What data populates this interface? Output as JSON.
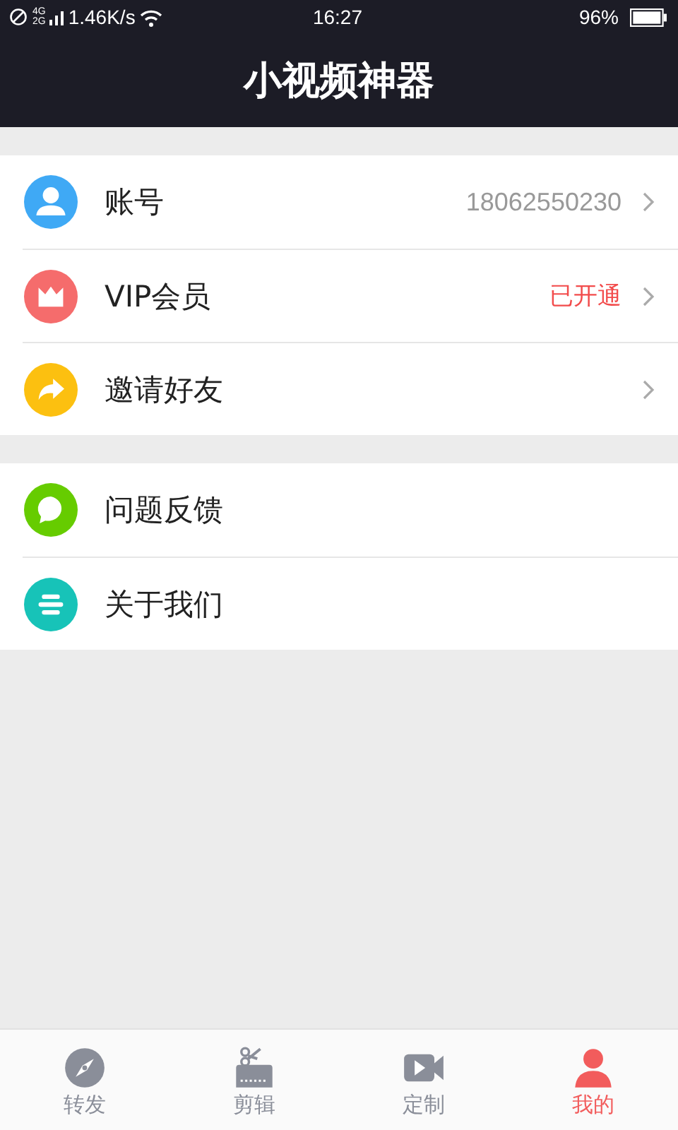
{
  "status_bar": {
    "network_top": "4G",
    "network_bottom": "2G",
    "speed": "1.46K/s",
    "time": "16:27",
    "battery": "96%"
  },
  "header": {
    "title": "小视频神器"
  },
  "groups": [
    {
      "items": [
        {
          "kind": "person",
          "color": "#3fa9f5",
          "label": "账号",
          "value": "18062550230",
          "highlighted": false,
          "has_arrow": true
        },
        {
          "kind": "crown",
          "color": "#f56c6c",
          "label": "VIP会员",
          "value": "已开通",
          "highlighted": true,
          "has_arrow": true
        },
        {
          "kind": "share",
          "color": "#fcc010",
          "label": "邀请好友",
          "has_arrow": true
        }
      ]
    },
    {
      "items": [
        {
          "kind": "chat",
          "color": "#66cc00",
          "label": "问题反馈",
          "has_arrow": false
        },
        {
          "kind": "lines",
          "color": "#17c3b8",
          "label": "关于我们",
          "has_arrow": false
        }
      ]
    }
  ],
  "tabs": [
    {
      "kind": "compass",
      "label": "转发",
      "selected": false
    },
    {
      "kind": "scissors",
      "label": "剪辑",
      "selected": false
    },
    {
      "kind": "video",
      "label": "定制",
      "selected": false
    },
    {
      "kind": "person",
      "label": "我的",
      "selected": true
    }
  ]
}
